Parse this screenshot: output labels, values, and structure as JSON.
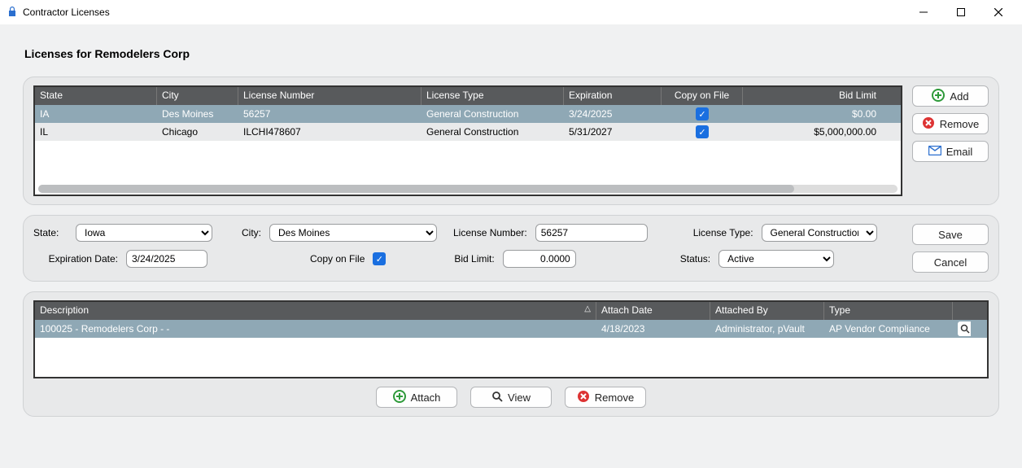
{
  "window": {
    "title": "Contractor Licenses"
  },
  "page_heading": "Licenses for Remodelers Corp",
  "licenses_grid": {
    "columns": {
      "state": "State",
      "city": "City",
      "license_number": "License Number",
      "license_type": "License Type",
      "expiration": "Expiration",
      "copy_on_file": "Copy on File",
      "bid_limit": "Bid Limit"
    },
    "rows": [
      {
        "state": "IA",
        "city": "Des Moines",
        "license_number": "56257",
        "license_type": "General Construction",
        "expiration": "3/24/2025",
        "copy_on_file": true,
        "bid_limit": "$0.00"
      },
      {
        "state": "IL",
        "city": "Chicago",
        "license_number": "ILCHI478607",
        "license_type": "General Construction",
        "expiration": "5/31/2027",
        "copy_on_file": true,
        "bid_limit": "$5,000,000.00"
      }
    ]
  },
  "side_buttons": {
    "add": "Add",
    "remove": "Remove",
    "email": "Email"
  },
  "form": {
    "labels": {
      "state": "State:",
      "city": "City:",
      "license_number": "License Number:",
      "license_type": "License Type:",
      "expiration_date": "Expiration Date:",
      "copy_on_file": "Copy on File",
      "bid_limit": "Bid Limit:",
      "status": "Status:"
    },
    "values": {
      "state": "Iowa",
      "city": "Des Moines",
      "license_number": "56257",
      "license_type": "General Construction",
      "expiration_date": "3/24/2025",
      "copy_on_file": true,
      "bid_limit": "0.0000",
      "status": "Active"
    },
    "buttons": {
      "save": "Save",
      "cancel": "Cancel"
    }
  },
  "docs_grid": {
    "columns": {
      "description": "Description",
      "attach_date": "Attach Date",
      "attached_by": "Attached By",
      "type": "Type"
    },
    "rows": [
      {
        "description": "100025 - Remodelers Corp -  -",
        "attach_date": "4/18/2023",
        "attached_by": "Administrator, pVault",
        "type": "AP Vendor Compliance"
      }
    ]
  },
  "docs_buttons": {
    "attach": "Attach",
    "view": "View",
    "remove": "Remove"
  }
}
